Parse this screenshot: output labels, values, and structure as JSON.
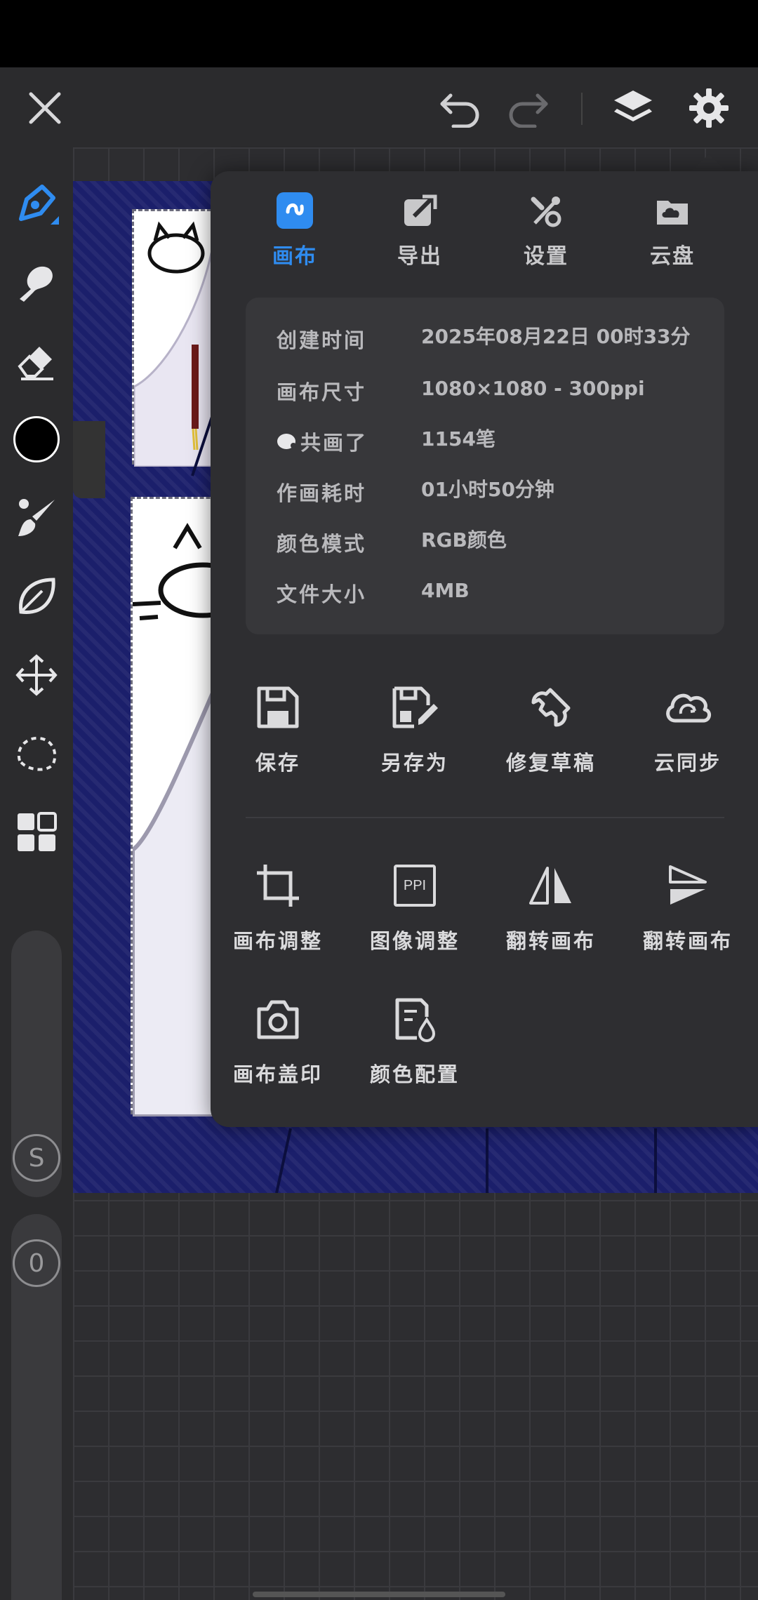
{
  "popup": {
    "tabs": [
      {
        "label": "画布",
        "icon": "canvas-icon",
        "active": true
      },
      {
        "label": "导出",
        "icon": "export-icon",
        "active": false
      },
      {
        "label": "设置",
        "icon": "settings-tools-icon",
        "active": false
      },
      {
        "label": "云盘",
        "icon": "cloud-drive-icon",
        "active": false
      }
    ],
    "info": [
      {
        "key": "创建时间",
        "value": "2025年08月22日  00时33分"
      },
      {
        "key": "画布尺寸",
        "value": "1080×1080 - 300ppi"
      },
      {
        "key": "共画了",
        "value": "1154笔"
      },
      {
        "key": "作画耗时",
        "value": "01小时50分钟"
      },
      {
        "key": "颜色模式",
        "value": "RGB颜色"
      },
      {
        "key": "文件大小",
        "value": "4MB"
      }
    ],
    "actions_row1": [
      {
        "label": "保存",
        "icon": "save-icon"
      },
      {
        "label": "另存为",
        "icon": "save-as-icon"
      },
      {
        "label": "修复草稿",
        "icon": "wrench-icon"
      },
      {
        "label": "云同步",
        "icon": "cloud-sync-icon"
      }
    ],
    "actions_row2": [
      {
        "label": "画布调整",
        "icon": "crop-icon"
      },
      {
        "label": "图像调整",
        "icon": "ppi-icon"
      },
      {
        "label": "翻转画布",
        "icon": "flip-horizontal-icon"
      },
      {
        "label": "翻转画布",
        "icon": "flip-vertical-icon"
      }
    ],
    "actions_row3": [
      {
        "label": "画布盖印",
        "icon": "camera-icon"
      },
      {
        "label": "颜色配置",
        "icon": "color-profile-icon"
      }
    ],
    "ppi_badge": "PPI"
  },
  "rail": {
    "slider_top_label": "S",
    "slider_bottom_label": "0",
    "current_color": "#000000"
  },
  "colors": {
    "accent": "#2f8cf0",
    "panel_bg": "#2e2e31",
    "canvas_bg": "#1b1f6b"
  }
}
